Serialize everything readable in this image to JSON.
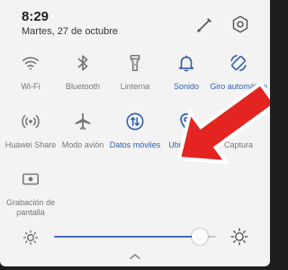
{
  "status": {
    "time": "8:29",
    "date": "Martes, 27 de octubre"
  },
  "header_icons": [
    "edit-icon",
    "settings-icon"
  ],
  "tiles": [
    {
      "label": "Wi-Fi",
      "icon": "wifi-icon",
      "active": false
    },
    {
      "label": "Bluetooth",
      "icon": "bluetooth-icon",
      "active": false
    },
    {
      "label": "Linterna",
      "icon": "flashlight-icon",
      "active": false
    },
    {
      "label": "Sonido",
      "icon": "bell-icon",
      "active": true
    },
    {
      "label": "Giro automático",
      "icon": "auto-rotate-icon",
      "active": true
    },
    {
      "label": "Huawei Share",
      "icon": "huawei-share-icon",
      "active": false
    },
    {
      "label": "Modo avión",
      "icon": "airplane-icon",
      "active": false
    },
    {
      "label": "Datos móviles",
      "icon": "mobile-data-icon",
      "active": true
    },
    {
      "label": "Ubicación",
      "icon": "location-icon",
      "active": true
    },
    {
      "label": "Captura",
      "icon": "screenshot-icon",
      "active": false
    },
    {
      "label": "Grabación de pantalla",
      "icon": "screen-record-icon",
      "active": false
    }
  ],
  "brightness": {
    "level": 0.9
  },
  "colors": {
    "accent": "#2d5fb2",
    "inactive": "#777777",
    "panel_bg": "#f3f3f3",
    "arrow": "#e32421"
  }
}
